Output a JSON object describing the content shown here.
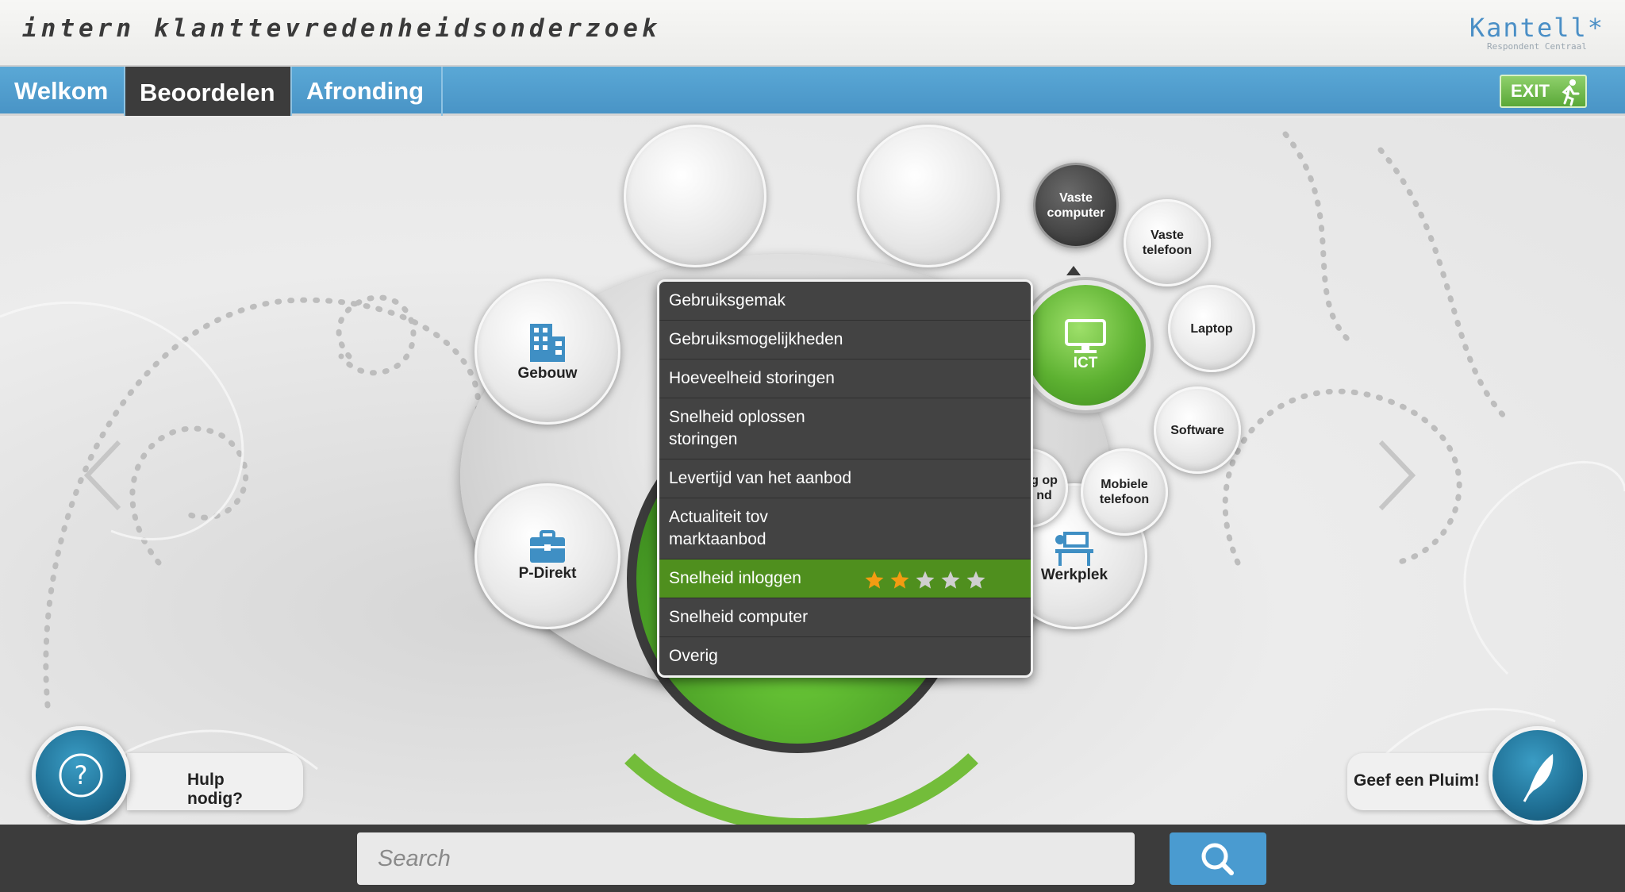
{
  "header": {
    "site_title": "intern klanttevredenheidsonderzoek",
    "brand_name": "Kantell*",
    "brand_sub": "Respondent Centraal"
  },
  "nav": {
    "tabs": [
      {
        "label": "Welkom"
      },
      {
        "label": "Beoordelen"
      },
      {
        "label": "Afronding"
      }
    ],
    "active_tab": "Beoordelen",
    "exit_label": "EXIT"
  },
  "categories": {
    "gebouw": "Gebouw",
    "p_direkt": "P-Direkt",
    "ict": "ICT",
    "werkplek": "Werkplek",
    "vaste_computer": "Vaste computer",
    "vaste_telefoon": "Vaste telefoon",
    "laptop": "Laptop",
    "software": "Software",
    "mobiele_telefoon": "Mobiele telefoon",
    "partial": "g op\nnd"
  },
  "menu": {
    "items": [
      {
        "label": "Gebruiksgemak"
      },
      {
        "label": "Gebruiksmogelijkheden"
      },
      {
        "label": "Hoeveelheid storingen"
      },
      {
        "label": "Snelheid oplossen\nstoringen"
      },
      {
        "label": "Levertijd van het aanbod"
      },
      {
        "label": "Actualiteit tov\nmarktaanbod"
      },
      {
        "label": "Snelheid inloggen",
        "selected": true,
        "rating": 2,
        "max_rating": 5
      },
      {
        "label": "Snelheid computer"
      },
      {
        "label": "Overig"
      }
    ]
  },
  "help": {
    "label": "Hulp nodig?"
  },
  "pluim": {
    "label": "Geef een Pluim!"
  },
  "search": {
    "placeholder": "Search"
  },
  "colors": {
    "accent_blue": "#4a9bd0",
    "accent_green": "#5db131",
    "star_on": "#f39c12",
    "star_off": "#cfcfcf"
  }
}
